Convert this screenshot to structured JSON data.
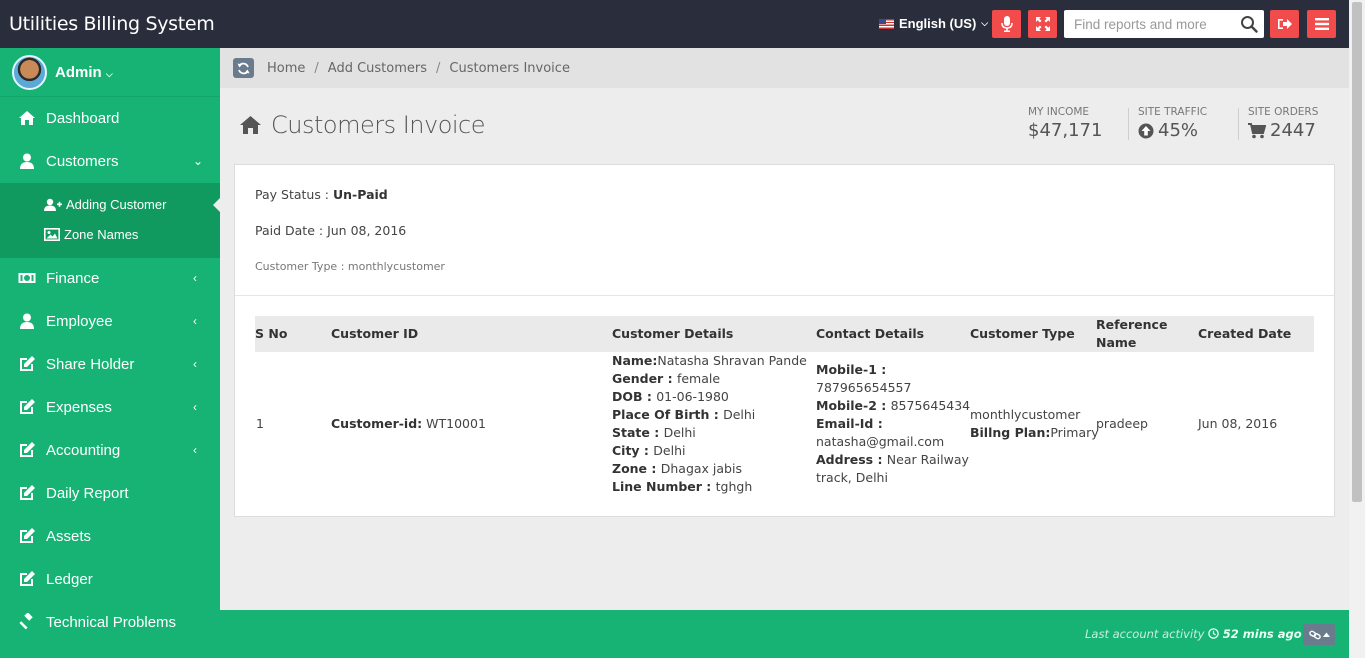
{
  "app": {
    "title": "Utilities Billing System"
  },
  "topbar": {
    "language": "English (US)",
    "search_placeholder": "Find reports and more",
    "icons": [
      "microphone-icon",
      "fullscreen-icon",
      "search-icon",
      "logout-icon",
      "menu-icon"
    ]
  },
  "user": {
    "name": "Admin"
  },
  "sidebar": {
    "items": [
      {
        "label": "Dashboard",
        "icon": "home-icon"
      },
      {
        "label": "Customers",
        "icon": "user-icon"
      },
      {
        "label": "Finance",
        "icon": "money-icon"
      },
      {
        "label": "Employee",
        "icon": "user-icon"
      },
      {
        "label": "Share Holder",
        "icon": "edit-icon"
      },
      {
        "label": "Expenses",
        "icon": "edit-icon"
      },
      {
        "label": "Accounting",
        "icon": "edit-icon"
      },
      {
        "label": "Daily Report",
        "icon": "edit-icon"
      },
      {
        "label": "Assets",
        "icon": "edit-icon"
      },
      {
        "label": "Ledger",
        "icon": "edit-icon"
      },
      {
        "label": "Technical Problems",
        "icon": "gavel-icon"
      }
    ],
    "submenu": [
      {
        "label": "Adding Customer",
        "icon": "user-plus-icon"
      },
      {
        "label": "Zone Names",
        "icon": "image-icon"
      }
    ]
  },
  "breadcrumb": [
    "Home",
    "Add Customers",
    "Customers Invoice"
  ],
  "page": {
    "title": "Customers Invoice"
  },
  "stats": [
    {
      "label": "MY INCOME",
      "value": "$47,171"
    },
    {
      "label": "SITE TRAFFIC",
      "value": "45%"
    },
    {
      "label": "SITE ORDERS",
      "value": "2447"
    }
  ],
  "invoice": {
    "pay_status_label": "Pay Status : ",
    "pay_status": "Un-Paid",
    "paid_date_label": "Paid Date : ",
    "paid_date": "Jun 08, 2016",
    "customer_type_line": "Customer Type : monthlycustomer"
  },
  "table": {
    "headers": [
      "S No",
      "Customer ID",
      "Customer Details",
      "Contact Details",
      "Customer Type",
      "Reference",
      "Name",
      "Created Date"
    ],
    "row": {
      "sno": "1",
      "customer_id_label": "Customer-id:",
      "customer_id": " WT10001",
      "name_label": "Name:",
      "name": "Natasha Shravan Pande",
      "gender_label": "Gender : ",
      "gender": "female",
      "dob_label": "DOB : ",
      "dob": "01-06-1980",
      "pob_label": "Place Of Birth : ",
      "pob": "Delhi",
      "state_label": "State : ",
      "state": "Delhi",
      "city_label": "City : ",
      "city": "Delhi",
      "zone_label": "Zone : ",
      "zone": "Dhagax jabis",
      "line_label": "Line Number : ",
      "line": "tghgh",
      "mobile1_label": "Mobile-1 :",
      "mobile1": "787965654557",
      "mobile2_label": "Mobile-2 : ",
      "mobile2": "8575645434",
      "email_label": "Email-Id :",
      "email": "natasha@gmail.com",
      "address_label": "Address : ",
      "address_1": "Near Railway",
      "address_2": "track, Delhi",
      "customer_type": "monthlycustomer",
      "plan_label": "Billng Plan:",
      "plan": "Primary",
      "reference": "pradeep",
      "created": "Jun 08, 2016"
    }
  },
  "footer": {
    "activity_label": "Last account activity ",
    "activity_time": "52 mins ago"
  }
}
